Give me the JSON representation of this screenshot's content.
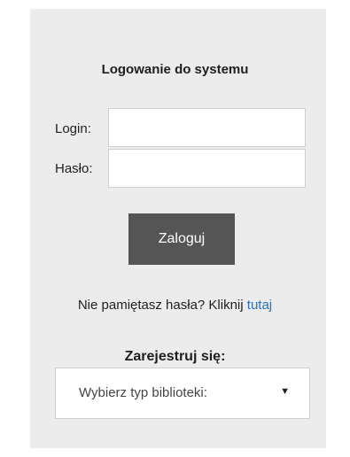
{
  "login_form": {
    "title": "Logowanie do systemu",
    "login_label": "Login:",
    "password_label": "Hasło:",
    "login_value": "",
    "password_value": "",
    "submit_label": "Zaloguj"
  },
  "forgot_password": {
    "text": "Nie pamiętasz hasła? Kliknij",
    "link_label": "tutaj"
  },
  "register": {
    "title": "Zarejestruj się:",
    "select_value": "Wybierz typ biblioteki:",
    "select_icon": "caret-down-icon"
  },
  "colors": {
    "panel_background": "#ececec",
    "button_background": "#555555",
    "link": "#2a73b8"
  }
}
